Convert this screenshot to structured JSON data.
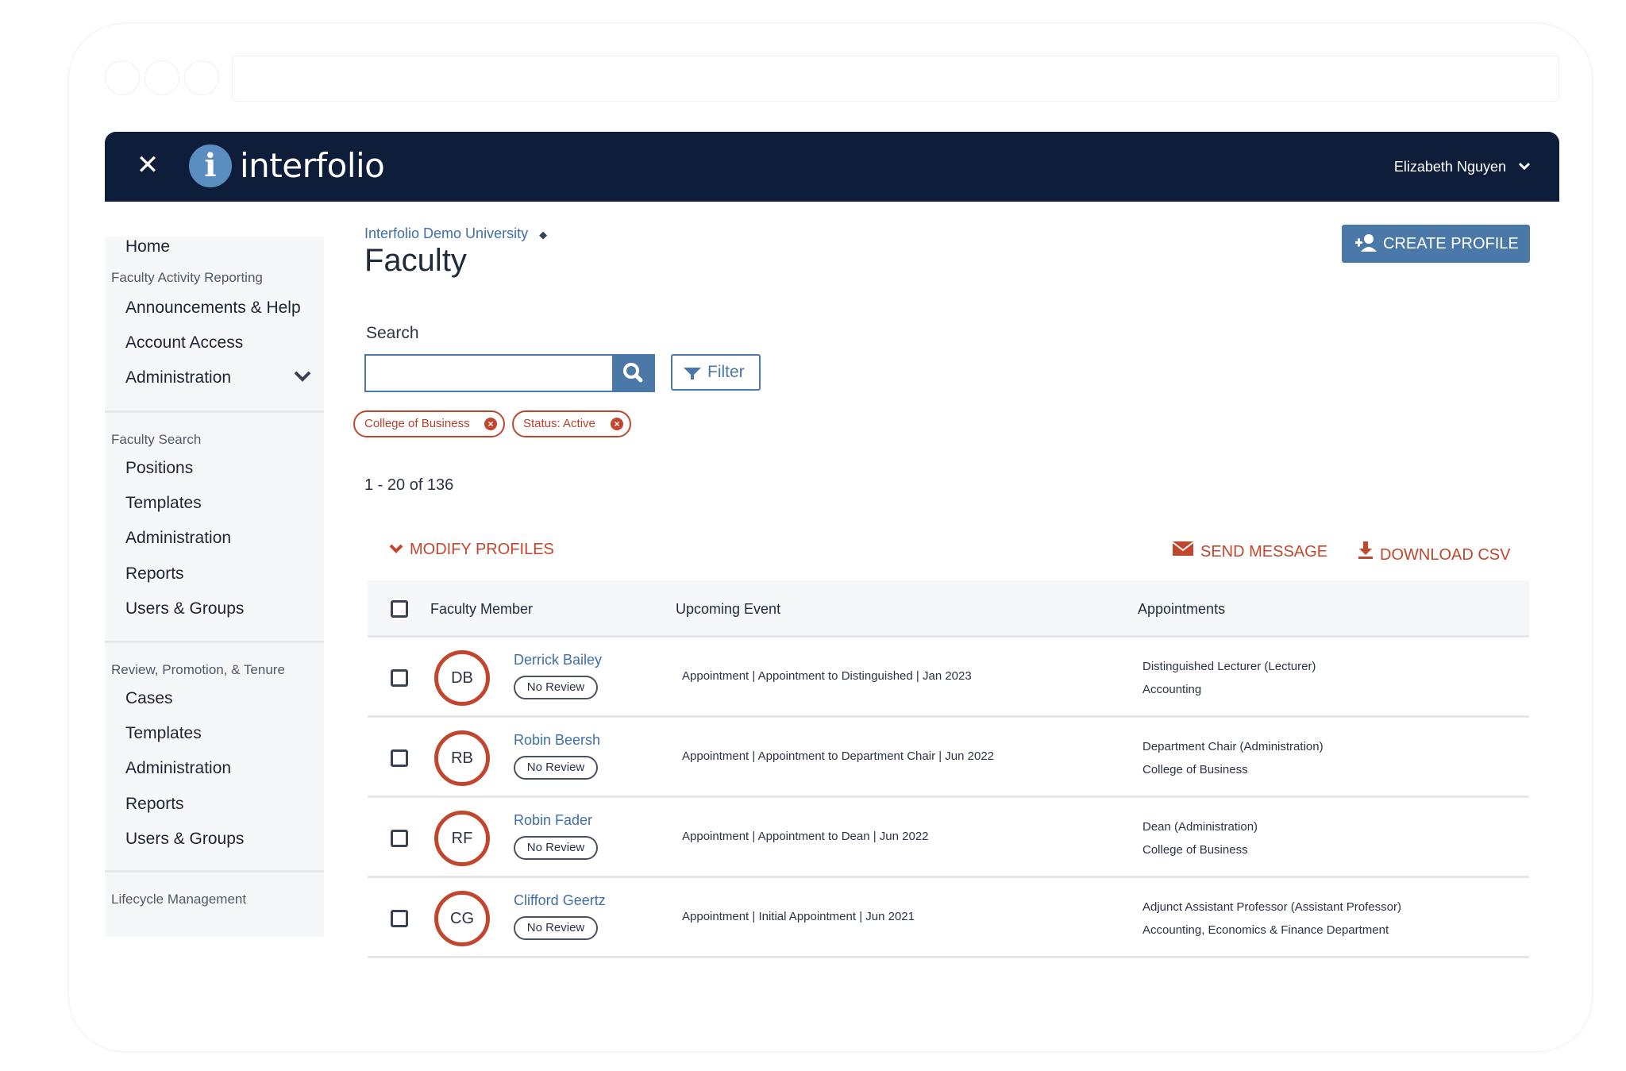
{
  "header": {
    "brand": "interfolio",
    "logo_letter": "i",
    "user_name": "Elizabeth Nguyen"
  },
  "sidebar": {
    "home": "Home",
    "section_far": "Faculty Activity Reporting",
    "far_items": [
      "Announcements & Help",
      "Account Access",
      "Administration"
    ],
    "section_search": "Faculty Search",
    "search_items": [
      "Positions",
      "Templates",
      "Administration",
      "Reports",
      "Users & Groups"
    ],
    "section_rpt": "Review, Promotion, & Tenure",
    "rpt_items": [
      "Cases",
      "Templates",
      "Administration",
      "Reports",
      "Users & Groups"
    ],
    "section_lifecycle": "Lifecycle Management"
  },
  "main": {
    "breadcrumb": "Interfolio Demo University",
    "title": "Faculty",
    "create_profile": "CREATE PROFILE",
    "search_label": "Search",
    "search_value": "",
    "filter_label": "Filter",
    "chips": [
      "College of Business",
      "Status: Active"
    ],
    "count_text": "1 - 20 of 136",
    "modify_profiles": "MODIFY PROFILES",
    "send_message": "SEND MESSAGE",
    "download_csv": "DOWNLOAD CSV"
  },
  "table": {
    "headers": [
      "Faculty Member",
      "Upcoming Event",
      "Appointments"
    ],
    "rows": [
      {
        "initials": "DB",
        "name": "Derrick Bailey",
        "review": "No Review",
        "event": "Appointment | Appointment to Distinguished | Jan 2023",
        "appt_title": "Distinguished Lecturer  (Lecturer)",
        "appt_unit": "Accounting"
      },
      {
        "initials": "RB",
        "name": "Robin Beersh",
        "review": "No Review",
        "event": "Appointment | Appointment to Department Chair | Jun 2022",
        "appt_title": "Department Chair  (Administration)",
        "appt_unit": "College of Business"
      },
      {
        "initials": "RF",
        "name": "Robin Fader",
        "review": "No Review",
        "event": "Appointment | Appointment to Dean | Jun 2022",
        "appt_title": "Dean (Administration)",
        "appt_unit": "College of Business"
      },
      {
        "initials": "CG",
        "name": "Clifford Geertz",
        "review": "No Review",
        "event": "Appointment | Initial Appointment | Jun 2021",
        "appt_title": "Adjunct Assistant Professor   (Assistant Professor)",
        "appt_unit": "Accounting, Economics & Finance Department"
      }
    ]
  },
  "colors": {
    "navy": "#0e1e3a",
    "accent_blue": "#4a78a8",
    "accent_red": "#c0472d"
  }
}
